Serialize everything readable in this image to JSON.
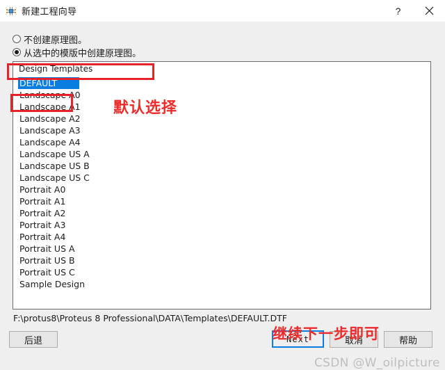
{
  "window": {
    "title": "新建工程向导",
    "icon": "chip-icon",
    "help_label": "?",
    "close_label": "×"
  },
  "options": {
    "no_schematic": {
      "label": "不创建原理图。",
      "selected": false
    },
    "from_template": {
      "label": "从选中的模版中创建原理图。",
      "selected": true
    }
  },
  "templates": {
    "group_label": "Design Templates",
    "selected": "DEFAULT",
    "items": [
      "DEFAULT",
      "Landscape A0",
      "Landscape A1",
      "Landscape A2",
      "Landscape A3",
      "Landscape A4",
      "Landscape US A",
      "Landscape US B",
      "Landscape US C",
      "Portrait A0",
      "Portrait A1",
      "Portrait A2",
      "Portrait A3",
      "Portrait A4",
      "Portrait US A",
      "Portrait US B",
      "Portrait US C",
      "Sample Design"
    ]
  },
  "file_path": "F:\\protus8\\Proteus 8 Professional\\DATA\\Templates\\DEFAULT.DTF",
  "buttons": {
    "back": "后退",
    "next": "Next",
    "cancel": "取消",
    "help": "帮助"
  },
  "annotations": {
    "default_selection": "默认选择",
    "continue_next": "继续下一步即可"
  },
  "watermark": "CSDN @W_oilpicture",
  "colors": {
    "accent": "#0a7de0",
    "annotation_red": "#ee2b2b",
    "window_bg": "#efefef",
    "panel_bg": "#ffffff"
  }
}
